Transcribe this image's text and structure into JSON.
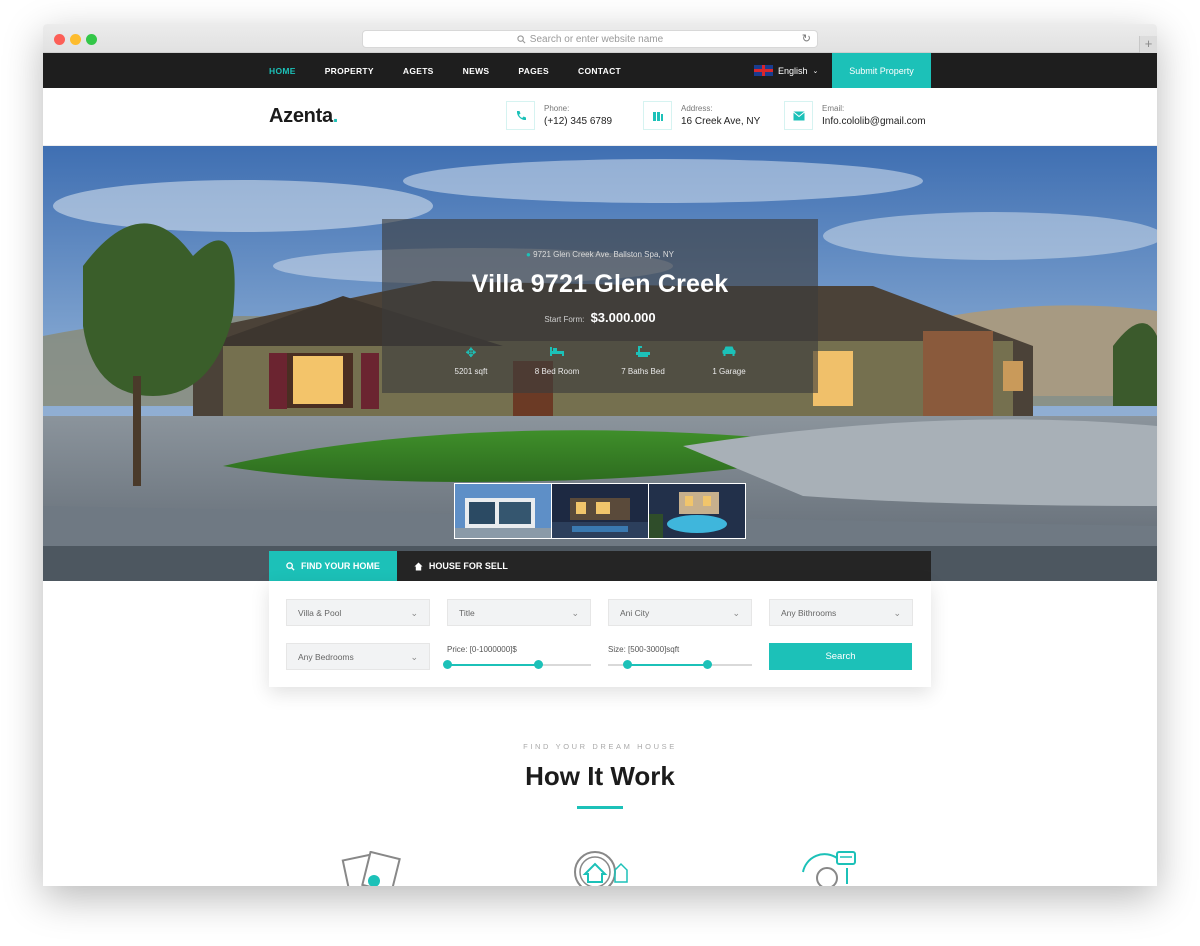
{
  "browser": {
    "url_placeholder": "Search or enter website name"
  },
  "nav": {
    "items": [
      "HOME",
      "PROPERTY",
      "AGETS",
      "NEWS",
      "PAGES",
      "CONTACT"
    ],
    "active": "HOME",
    "language": "English",
    "submit_label": "Submit Property"
  },
  "brand": {
    "name": "Azenta",
    "dot": "."
  },
  "contacts": [
    {
      "label": "Phone:",
      "value": "(+12) 345 6789",
      "icon": "phone-icon"
    },
    {
      "label": "Address:",
      "value": "16 Creek Ave, NY",
      "icon": "building-icon"
    },
    {
      "label": "Email:",
      "value": "Info.cololib@gmail.com",
      "icon": "mail-icon"
    }
  ],
  "hero": {
    "address": "9721 Glen Creek Ave. Ballston Spa, NY",
    "title": "Villa 9721 Glen Creek",
    "price_label": "Start Form:",
    "price": "$3.000.000",
    "features": [
      {
        "text": "5201 sqft",
        "icon": "area-icon"
      },
      {
        "text": "8 Bed Room",
        "icon": "bed-icon"
      },
      {
        "text": "7 Baths Bed",
        "icon": "bath-icon"
      },
      {
        "text": "1 Garage",
        "icon": "car-icon"
      }
    ]
  },
  "search": {
    "tabs": [
      "FIND YOUR HOME",
      "HOUSE FOR SELL"
    ],
    "selects": [
      "Villa & Pool",
      "Title",
      "Ani City",
      "Any Bithrooms",
      "Any Bedrooms"
    ],
    "price_label": "Price:",
    "price_range": "[0-1000000]$",
    "size_label": "Size:",
    "size_range": "[500-3000]sqft",
    "price_slider": {
      "min": 0,
      "max": 0.63
    },
    "size_slider": {
      "min": 0.13,
      "max": 0.69
    },
    "button": "Search"
  },
  "how": {
    "subtitle": "FIND YOUR DREAM HOUSE",
    "title": "How It Work"
  },
  "colors": {
    "accent": "#1cc1b8",
    "dark": "#1e1e1e"
  }
}
